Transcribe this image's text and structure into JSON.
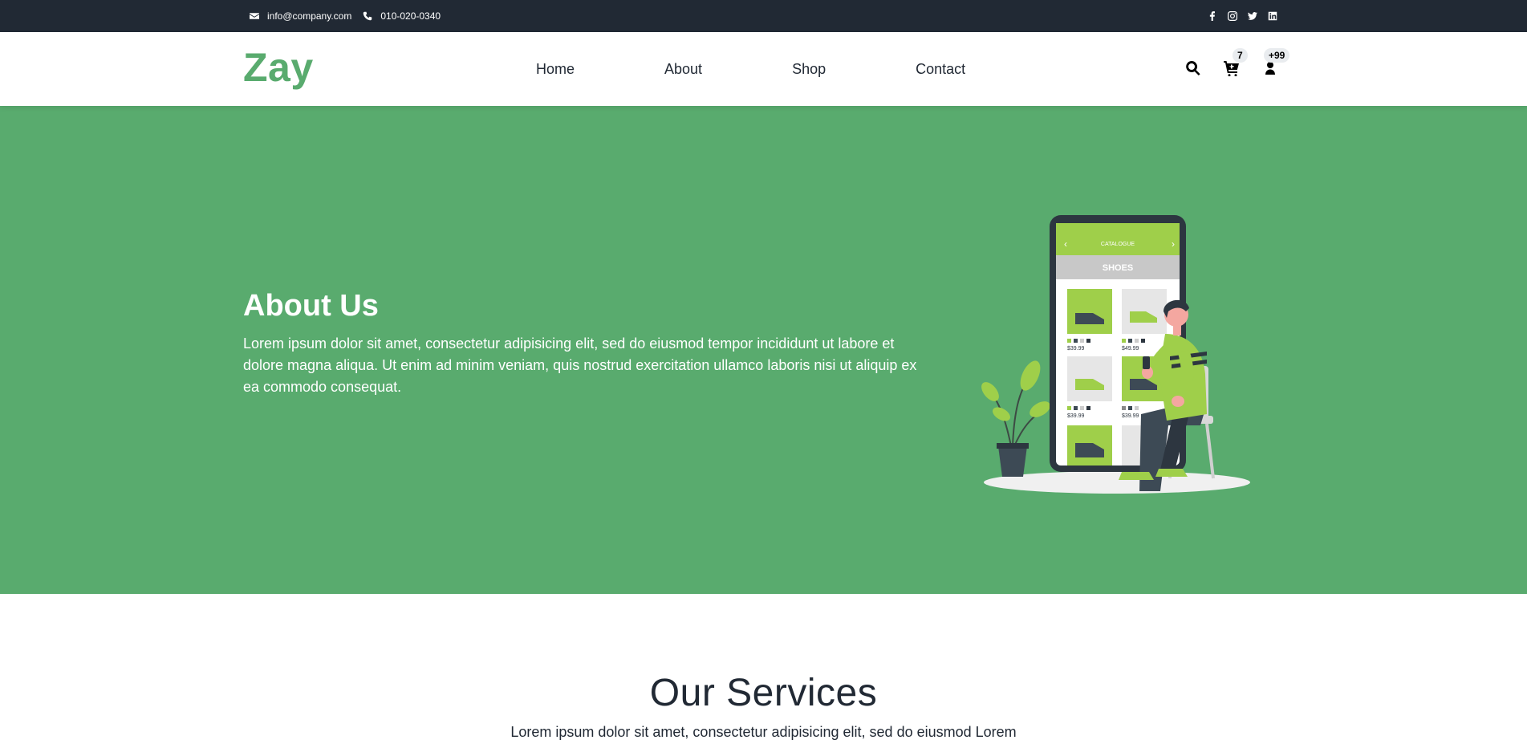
{
  "topbar": {
    "email": "info@company.com",
    "phone": "010-020-0340",
    "social": [
      "facebook-icon",
      "instagram-icon",
      "twitter-icon",
      "linkedin-icon"
    ]
  },
  "navbar": {
    "logo": "Zay",
    "menu": [
      "Home",
      "About",
      "Shop",
      "Contact"
    ],
    "cart_count": "7",
    "user_count": "+99"
  },
  "hero": {
    "title": "About Us",
    "text": "Lorem ipsum dolor sit amet, consectetur adipisicing elit, sed do eiusmod tempor incididunt ut labore et dolore magna aliqua. Ut enim ad minim veniam, quis nostrud exercitation ullamco laboris nisi ut aliquip ex ea commodo consequat.",
    "illustration": {
      "header": "CATALOGUE",
      "category": "SHOES",
      "prices": [
        "$39.99",
        "$49.99",
        "$39.99",
        "$39.99"
      ]
    }
  },
  "services": {
    "title": "Our Services",
    "text": "Lorem ipsum dolor sit amet, consectetur adipisicing elit, sed do eiusmod Lorem"
  },
  "colors": {
    "brand": "#59ab6e",
    "dark": "#212934",
    "accent": "#9fcf4a"
  }
}
